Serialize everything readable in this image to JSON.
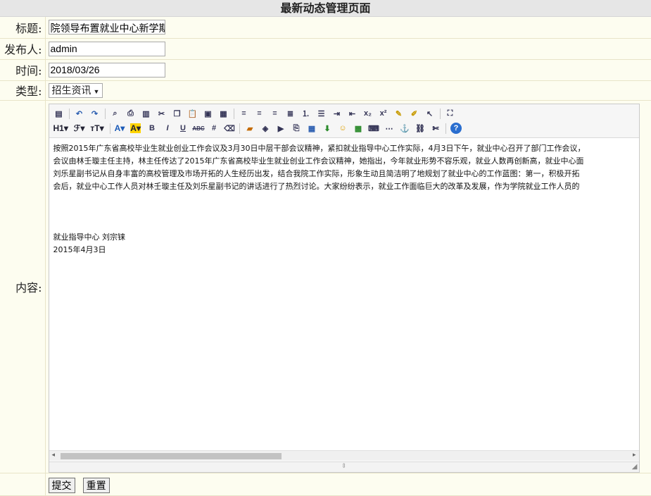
{
  "header": {
    "title": "最新动态管理页面"
  },
  "form": {
    "title_label": "标题:",
    "title_value": "院领导布置就业中心新学期",
    "publisher_label": "发布人:",
    "publisher_value": "admin",
    "time_label": "时间:",
    "time_value": "2018/03/26",
    "type_label": "类型:",
    "type_value": "招生资讯",
    "content_label": "内容:"
  },
  "editor": {
    "toolbar_row2_text": {
      "heading": "H1",
      "font": "ℱ",
      "size": "тT",
      "bold": "B",
      "italic": "I",
      "underline": "U",
      "strike": "ABC"
    },
    "lines": [
      "按照2015年广东省高校毕业生就业创业工作会议及3月30日中层干部会议精神，紧扣就业指导中心工作实际，4月3日下午，就业中心召开了部门工作会议，",
      "会议由林壬璇主任主持，林主任传达了2015年广东省高校毕业生就业创业工作会议精神，她指出，今年就业形势不容乐观，就业人数再创新高，就业中心面",
      "刘乐星副书记从自身丰富的高校管理及市场开拓的人生经历出发，结合我院工作实际，形象生动且简洁明了地规划了就业中心的工作蓝图：第一，积极开拓",
      "会后，就业中心工作人员对林壬璇主任及刘乐星副书记的讲话进行了热烈讨论。大家纷纷表示，就业工作面临巨大的改革及发展，作为学院就业工作人员的"
    ],
    "signature": "就业指导中心 刘宗铼",
    "date": "2015年4月3日"
  },
  "actions": {
    "submit_label": "提交",
    "reset_label": "重置"
  }
}
